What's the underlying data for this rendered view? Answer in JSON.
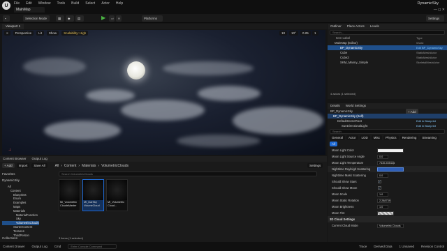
{
  "app": {
    "logo": "U",
    "project": "DynamicSky",
    "tab": "MainMap",
    "menu": [
      "File",
      "Edit",
      "Window",
      "Tools",
      "Build",
      "Select",
      "Actor",
      "Help"
    ],
    "window_controls": "— ◻ ✕"
  },
  "toolbar": {
    "select_mode": "Selection Mode",
    "platforms": "Platforms",
    "play": "▶",
    "settings": "Settings"
  },
  "viewport": {
    "tab": "Viewport 1",
    "perspective": "Perspective",
    "lit": "Lit",
    "show": "Show",
    "scalability": "Scalability: High",
    "fov": "0.25",
    "grid": "10",
    "angle": "10°",
    "cam": "1"
  },
  "outliner": {
    "tabs": [
      "Outliner",
      "Place Actors",
      "Levels"
    ],
    "search_placeholder": "Search...",
    "col_label": "Item Label",
    "col_type": "Type",
    "rows": [
      {
        "label": "MainMap (Editor)",
        "type": "World"
      },
      {
        "label": "BP_DynamicSky",
        "type": "Edit BP_DynamicSky"
      },
      {
        "label": "Cube",
        "type": "StaticMeshActor"
      },
      {
        "label": "Cube2",
        "type": "StaticMeshActor"
      },
      {
        "label": "SKM_Manny_Simple",
        "type": "SkeletalMeshActor"
      }
    ],
    "count": "4 actors (1 selected)"
  },
  "details": {
    "tabs": [
      "Details",
      "World Settings"
    ],
    "actor": "BP_DynamicSky",
    "add": "+ Add",
    "self": "BP_DynamicSky (Self)",
    "comp1": "DefaultSceneRoot",
    "comp2": "SunDirectionalLight",
    "edit_bp": "Edit in Blueprint",
    "search_placeholder": "Search",
    "filters": [
      "General",
      "Actor",
      "LOD",
      "Misc",
      "Physics",
      "Rendering",
      "Streaming",
      "All"
    ],
    "props": [
      {
        "label": "Moon Light Color",
        "value": ""
      },
      {
        "label": "Moon Light Source Angle",
        "value": "0.0"
      },
      {
        "label": "Moon Light Temperature",
        "value": "7435.455444"
      },
      {
        "label": "Nighttime Rayleigh Scattering",
        "value": ""
      },
      {
        "label": "Nighttime Mask Scattering",
        "value": "0.0"
      },
      {
        "label": "Should Show Stars",
        "value": "✓"
      },
      {
        "label": "Should Show Moon",
        "value": "✓"
      },
      {
        "label": "Moon Scale",
        "value": "1.0"
      },
      {
        "label": "Moon Static Rotation",
        "value": "2.288739"
      },
      {
        "label": "Moon Brightness",
        "value": "1.0"
      },
      {
        "label": "Moon Tint",
        "value": ""
      }
    ],
    "section": "3D Cloud Settings",
    "cloud_mode_label": "Current Cloud Mode",
    "cloud_mode": "Volumetric Clouds"
  },
  "content": {
    "tabs": [
      "Content Browser",
      "Output Log"
    ],
    "add": "+ Add",
    "import": "Import",
    "save_all": "Save All",
    "settings": "Settings",
    "path": [
      "All",
      "Content",
      "Materials",
      "VolumetricClouds"
    ],
    "favorites": "Favorites",
    "project": "DynamicSky",
    "tree": [
      "All",
      "Content",
      "Blueprints",
      "Enum",
      "Examples",
      "Maps",
      "Materials",
      "MaterialFunction",
      "Sky",
      "VolumetricClouds",
      "StarterContent",
      "Textures",
      "ThirdPerson"
    ],
    "search_placeholder": "Search VolumetricClouds",
    "assets": [
      {
        "name": "MI_Volumetric CloudsMaster",
        "sub": "Material Instance"
      },
      {
        "name": "MI_DarSky VolumeCloud",
        "sub": "Material Instance"
      },
      {
        "name": "MI_Volumetric Cloud...",
        "sub": "Material Instance"
      }
    ],
    "items": "3 items (1 selected)",
    "collections": "Collections"
  },
  "bottombar": {
    "drawer": "Content Drawer",
    "output": "Output Log",
    "cmd": "Cmd",
    "cmd_placeholder": "Enter Console Command",
    "trace": "Trace",
    "derived": "Derived Data",
    "unsaved": "1 Unsaved",
    "revision": "Revision Control"
  }
}
